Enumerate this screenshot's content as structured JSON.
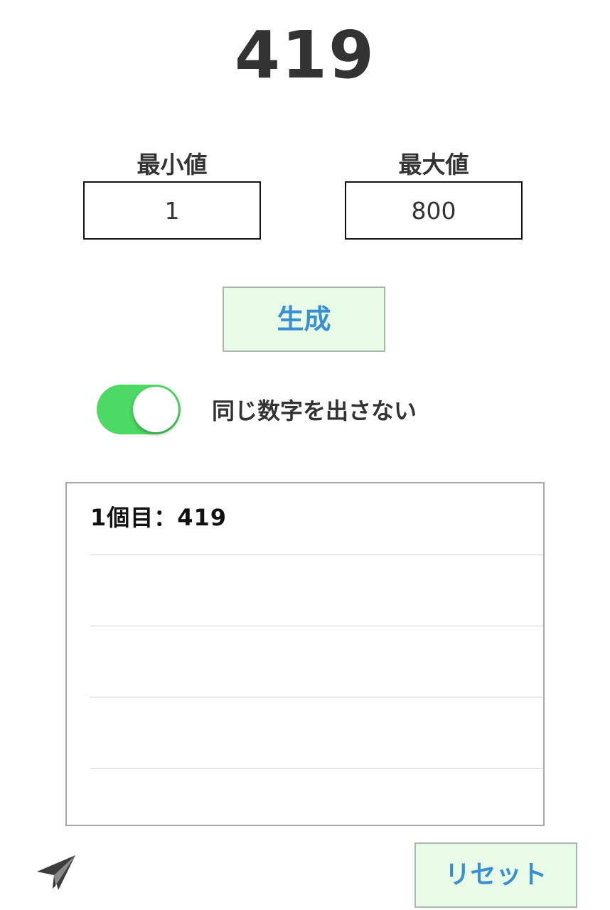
{
  "result": {
    "value": "419"
  },
  "range": {
    "min_label": "最小値",
    "min_value": "1",
    "max_label": "最大値",
    "max_value": "800"
  },
  "generate": {
    "label": "生成"
  },
  "no_repeat": {
    "label": "同じ数字を出さない",
    "enabled": true
  },
  "history": {
    "rows": [
      "1個目：419",
      "",
      "",
      "",
      ""
    ]
  },
  "reset": {
    "label": "リセット"
  },
  "colors": {
    "toggle_on": "#4cd964",
    "button_bg": "#e8fbe6",
    "button_text": "#3a8fd2"
  },
  "icons": {
    "share": "paper-plane-icon"
  }
}
